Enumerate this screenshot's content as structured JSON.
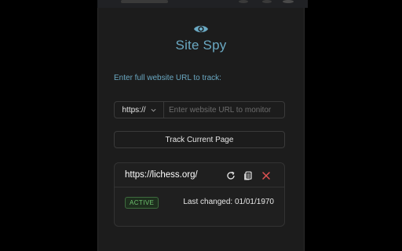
{
  "app": {
    "title": "Site Spy",
    "icon": "eye-icon",
    "accent_color": "#6aa8c2"
  },
  "form": {
    "hint": "Enter full website URL to track:",
    "protocol": {
      "selected": "https://",
      "icon": "chevron-down-icon"
    },
    "url_input": {
      "value": "",
      "placeholder": "Enter website URL to monitor"
    },
    "track_button_label": "Track Current Page"
  },
  "tracked_sites": [
    {
      "url": "https://lichess.org/",
      "status": "ACTIVE",
      "status_color": "#6fc36f",
      "last_changed": "Last changed: 01/01/1970",
      "actions": [
        {
          "name": "refresh-icon",
          "color": "#e6e6e6"
        },
        {
          "name": "copy-icon",
          "color": "#e6e6e6"
        },
        {
          "name": "delete-icon",
          "color": "#e05252"
        }
      ]
    }
  ]
}
